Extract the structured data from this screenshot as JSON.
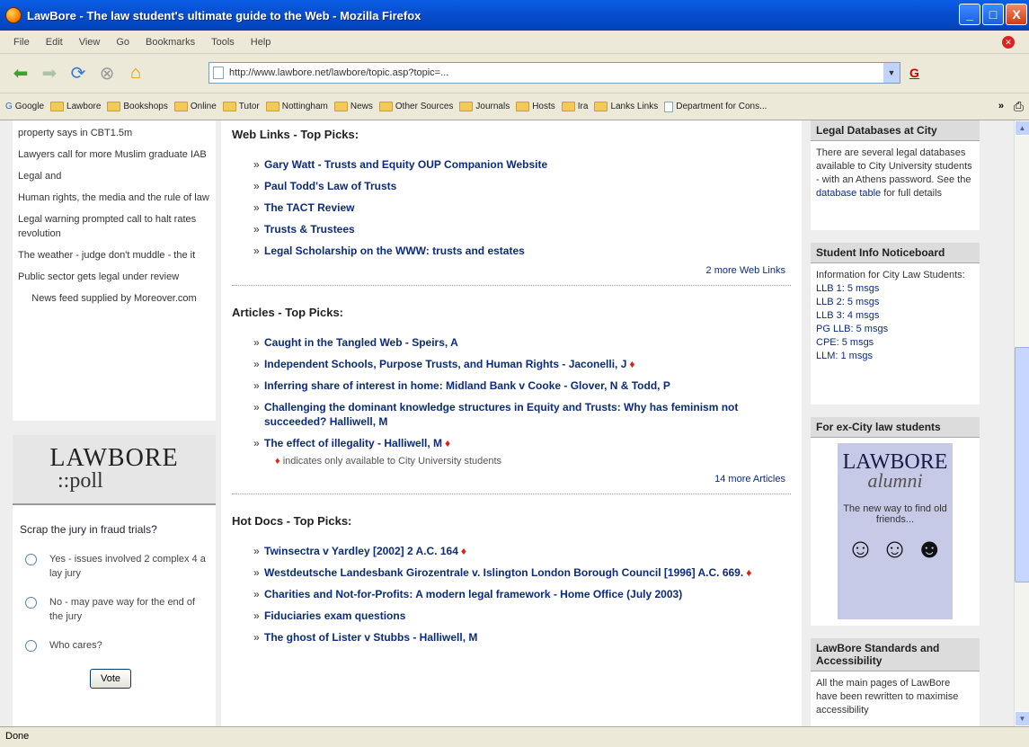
{
  "window": {
    "title": "LawBore - The law student's ultimate guide to the Web - Mozilla Firefox",
    "minimize": "_",
    "maximize": "□",
    "close": "X"
  },
  "menu": [
    "File",
    "Edit",
    "View",
    "Go",
    "Bookmarks",
    "Tools",
    "Help"
  ],
  "address": {
    "url": "http://www.lawbore.net/lawbore/topic.asp?topic=..."
  },
  "bookmarks": [
    "Google",
    "Lawbore",
    "Bookshops",
    "Online",
    "Tutor",
    "Nottingham",
    "News",
    "Other Sources",
    "Journals",
    "Hosts",
    "Ira",
    "Lanks Links",
    "Department for Cons..."
  ],
  "left": {
    "news": [
      "property says in CBT1.5m",
      "Lawyers call for more Muslim graduate IAB",
      "Legal and",
      "Human rights, the media and the rule of law",
      "Legal warning prompted call to halt rates revolution",
      "The weather - judge don't muddle - the it",
      "Public sector gets legal under review"
    ],
    "credit": "News feed supplied by Moreover.com",
    "poll": {
      "logo_top": "LAWBORE",
      "logo_bottom": "::poll",
      "question": "Scrap the jury in fraud trials?",
      "options": [
        "Yes - issues involved 2 complex 4 a lay jury",
        "No - may pave way for the end of the jury",
        "Who cares?"
      ],
      "vote": "Vote"
    }
  },
  "main": {
    "web_links": {
      "title": "Web Links - Top Picks:",
      "items": [
        "Gary Watt - Trusts and Equity OUP Companion Website",
        "Paul Todd's Law of Trusts",
        "The TACT Review",
        "Trusts & Trustees",
        "Legal Scholarship on the WWW: trusts and estates"
      ],
      "more": "2 more Web Links"
    },
    "articles": {
      "title": "Articles - Top Picks:",
      "items": [
        {
          "text": "Caught in the Tangled Web - Speirs, A",
          "mark": ""
        },
        {
          "text": "Independent Schools, Purpose Trusts, and Human Rights - Jaconelli, J",
          "mark": "♦"
        },
        {
          "text": "Inferring share of interest in home: Midland Bank v Cooke - Glover, N & Todd, P",
          "mark": ""
        },
        {
          "text": "Challenging the dominant knowledge structures in Equity and Trusts: Why has feminism not succeeded? Halliwell, M",
          "mark": ""
        },
        {
          "text": "The effect of illegality - Halliwell, M",
          "mark": "♦"
        }
      ],
      "legend_mark": "♦",
      "legend": "indicates only available to City University students",
      "more": "14 more Articles"
    },
    "hot_docs": {
      "title": "Hot Docs - Top Picks:",
      "items": [
        {
          "text": "Twinsectra v Yardley [2002] 2 A.C. 164",
          "mark": "♦"
        },
        {
          "text": "Westdeutsche Landesbank Girozentrale v. Islington London Borough Council [1996] A.C. 669.",
          "mark": "♦"
        },
        {
          "text": "Charities and Not-for-Profits: A modern legal framework - Home Office (July 2003)",
          "mark": ""
        },
        {
          "text": "Fiduciaries exam questions",
          "mark": ""
        },
        {
          "text": "The ghost of Lister v Stubbs - Halliwell, M",
          "mark": ""
        }
      ]
    }
  },
  "right": {
    "legal_db": {
      "title": "Legal Databases at City",
      "text": "There are several legal databases available to City University students - with an Athens password. See the",
      "link": "database table",
      "text_after": "for full details"
    },
    "notice": {
      "title": "Student Info Noticeboard",
      "intro": "Information for City Law Students:",
      "lines": [
        "LLB 1: 5 msgs",
        "LLB 2: 5 msgs",
        "LLB 3: 4 msgs",
        "PG LLB: 5 msgs",
        "CPE: 5 msgs",
        "LLM: 1 msgs"
      ]
    },
    "alumni": {
      "title": "For ex-City law students",
      "logo_top": "LAWBORE",
      "logo_bottom": "alumni",
      "tagline": "The new way to find old friends...",
      "faces": "☺ ☺ ☻"
    },
    "standards": {
      "title": "LawBore Standards and Accessibility",
      "text": "All the main pages of LawBore have been rewritten to maximise accessibility"
    }
  },
  "status": "Done"
}
